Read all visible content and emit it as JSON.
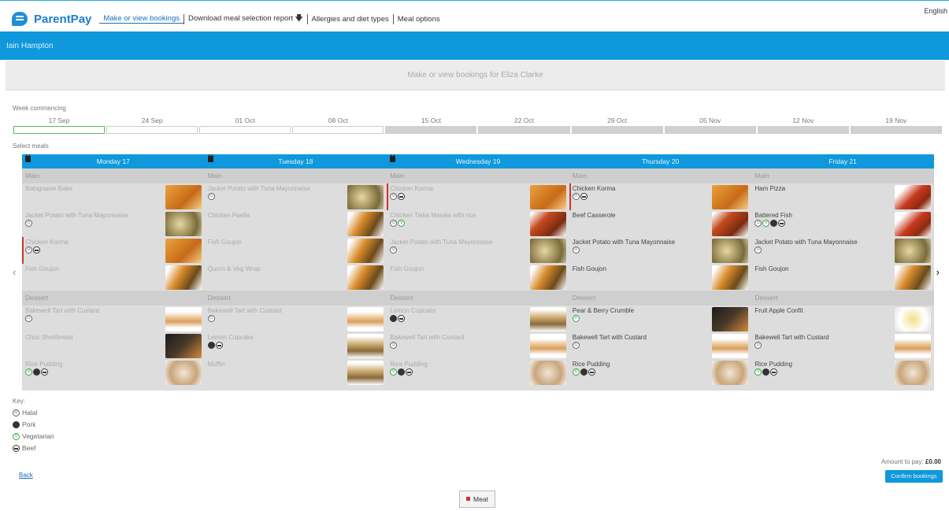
{
  "header": {
    "brand": "ParentPay",
    "language": "English",
    "nav": [
      "Make or view bookings",
      "Download meal selection report",
      "Allergies and diet types",
      "Meal options"
    ],
    "download_icon": "down-arrow-icon"
  },
  "user_name": "Iain Hampton",
  "page_title": "Make or view bookings for Eliza Clarke",
  "week_commencing": {
    "label": "Week commencing",
    "weeks": [
      "17 Sep",
      "24 Sep",
      "01 Oct",
      "08 Oct",
      "15 Oct",
      "22 Oct",
      "29 Oct",
      "05 Nov",
      "12 Nov",
      "19 Nov"
    ],
    "selected": "17 Sep"
  },
  "select_meals_label": "Select meals",
  "days": [
    {
      "name": "Monday 17",
      "locked": true,
      "main_label": "Main",
      "main": [
        {
          "name": "Bolognaise Bake",
          "icons": [],
          "thumb": "orange"
        },
        {
          "name": "Jacket Potato with Tuna Mayonnaise",
          "icons": [
            "halal"
          ],
          "thumb": "potato"
        },
        {
          "name": "Chicken Korma",
          "icons": [
            "halal",
            "beef"
          ],
          "thumb": "orange",
          "booked": true
        },
        {
          "name": "Fish Goujon",
          "icons": [],
          "thumb": "fish"
        }
      ],
      "dessert_label": "Dessert",
      "dessert": [
        {
          "name": "Bakewell Tart with Custard",
          "icons": [
            "halal"
          ],
          "thumb": "tart"
        },
        {
          "name": "Choc Shortbread",
          "icons": [],
          "thumb": "dark"
        },
        {
          "name": "Rice Pudding",
          "icons": [
            "vegetarian",
            "pork",
            "beef"
          ],
          "thumb": "pud"
        }
      ]
    },
    {
      "name": "Tuesday 18",
      "locked": true,
      "main_label": "Main",
      "main": [
        {
          "name": "Jacket Potato with Tuna Mayonnaise",
          "icons": [
            "halal"
          ],
          "thumb": "potato"
        },
        {
          "name": "Chicken Paella",
          "icons": [],
          "thumb": "fish"
        },
        {
          "name": "Fish Goujon",
          "icons": [],
          "thumb": "fish"
        },
        {
          "name": "Quorn & Veg Wrap",
          "icons": [],
          "thumb": "fish"
        }
      ],
      "dessert_label": "Dessert",
      "dessert": [
        {
          "name": "Bakewell Tart with Custard",
          "icons": [
            "halal"
          ],
          "thumb": "tart"
        },
        {
          "name": "Lemon Cupcake",
          "icons": [
            "pork",
            "beef"
          ],
          "thumb": "cake"
        },
        {
          "name": "Muffin",
          "icons": [],
          "thumb": "cake"
        }
      ]
    },
    {
      "name": "Wednesday 19",
      "locked": true,
      "main_label": "Main",
      "main": [
        {
          "name": "Chicken Korma",
          "icons": [
            "halal",
            "beef"
          ],
          "thumb": "orange",
          "booked": true
        },
        {
          "name": "Chicken Tikka Masala with rice",
          "icons": [
            "halal",
            "vegetarian"
          ],
          "thumb": "red"
        },
        {
          "name": "Jacket Potato with Tuna Mayonnaise",
          "icons": [
            "halal"
          ],
          "thumb": "potato"
        },
        {
          "name": "Fish Goujon",
          "icons": [],
          "thumb": "fish"
        }
      ],
      "dessert_label": "Dessert",
      "dessert": [
        {
          "name": "Lemon Cupcake",
          "icons": [
            "pork",
            "beef"
          ],
          "thumb": "cake"
        },
        {
          "name": "Bakewell Tart with Custard",
          "icons": [
            "halal"
          ],
          "thumb": "tart"
        },
        {
          "name": "Rice Pudding",
          "icons": [
            "vegetarian",
            "pork",
            "beef"
          ],
          "thumb": "pud"
        }
      ]
    },
    {
      "name": "Thursday 20",
      "locked": false,
      "main_label": "Main",
      "main": [
        {
          "name": "Chicken Korma",
          "icons": [
            "halal",
            "beef"
          ],
          "thumb": "orange",
          "booked": true
        },
        {
          "name": "Beef Casserole",
          "icons": [],
          "thumb": "red"
        },
        {
          "name": "Jacket Potato with Tuna Mayonnaise",
          "icons": [
            "halal"
          ],
          "thumb": "potato"
        },
        {
          "name": "Fish Goujon",
          "icons": [],
          "thumb": "fish"
        }
      ],
      "dessert_label": "Dessert",
      "dessert": [
        {
          "name": "Pear & Berry Crumble",
          "icons": [
            "vegetarian"
          ],
          "thumb": "dark"
        },
        {
          "name": "Bakewell Tart with Custard",
          "icons": [
            "halal"
          ],
          "thumb": "tart"
        },
        {
          "name": "Rice Pudding",
          "icons": [
            "vegetarian",
            "pork",
            "beef"
          ],
          "thumb": "pud"
        }
      ]
    },
    {
      "name": "Friday 21",
      "locked": false,
      "main_label": "Main",
      "main": [
        {
          "name": "Ham Pizza",
          "icons": [],
          "thumb": "pizza"
        },
        {
          "name": "Battered Fish",
          "icons": [
            "halal",
            "vegetarian",
            "pork",
            "beef"
          ],
          "thumb": "pizza"
        },
        {
          "name": "Jacket Potato with Tuna Mayonnaise",
          "icons": [
            "halal"
          ],
          "thumb": "potato"
        },
        {
          "name": "Fish Goujon",
          "icons": [],
          "thumb": "fish"
        }
      ],
      "dessert_label": "Dessert",
      "dessert": [
        {
          "name": "Fruit Apple Confit",
          "icons": [],
          "thumb": "apple"
        },
        {
          "name": "Bakewell Tart with Custard",
          "icons": [
            "halal"
          ],
          "thumb": "tart"
        },
        {
          "name": "Rice Pudding",
          "icons": [
            "vegetarian",
            "pork",
            "beef"
          ],
          "thumb": "pud"
        }
      ]
    }
  ],
  "key": {
    "title": "Key:",
    "items": [
      {
        "icon": "halal",
        "label": "Halal"
      },
      {
        "icon": "pork",
        "label": "Pork"
      },
      {
        "icon": "vegetarian",
        "label": "Vegetarian"
      },
      {
        "icon": "beef",
        "label": "Beef"
      }
    ]
  },
  "amount": {
    "label": "Amount to pay:",
    "value": "£0.00"
  },
  "confirm_label": "Confirm bookings",
  "back_label": "Back",
  "meat_button_label": "Meat",
  "colors": {
    "accent": "#0f98dc",
    "booked": "#d9302b",
    "vegetarian": "#3aa24a"
  }
}
